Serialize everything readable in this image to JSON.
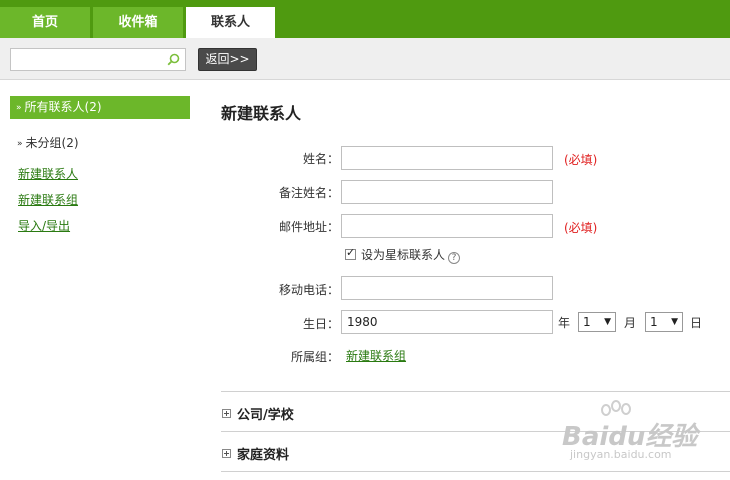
{
  "tabs": [
    {
      "label": "首页",
      "active": false
    },
    {
      "label": "收件箱",
      "active": false
    },
    {
      "label": "联系人",
      "active": true
    }
  ],
  "toolbar": {
    "search_value": "",
    "search_icon": "search-icon",
    "back_label": "返回>>"
  },
  "sidebar": {
    "header": "所有联系人(2)",
    "group": "未分组(2)",
    "links": [
      "新建联系人",
      "新建联系组",
      "导入/导出"
    ]
  },
  "main": {
    "title": "新建联系人",
    "fields": {
      "name_label": "姓名：",
      "name_value": "",
      "name_required": "(必填)",
      "alias_label": "备注姓名：",
      "alias_value": "",
      "email_label": "邮件地址：",
      "email_value": "",
      "email_required": "(必填)",
      "star_label": "设为星标联系人",
      "star_checked": true,
      "help_icon": "help-icon",
      "mobile_label": "移动电话：",
      "mobile_value": "",
      "birthday_label": "生日：",
      "birth_year": "1980",
      "year_unit": "年",
      "birth_month": "1",
      "month_unit": "月",
      "birth_day": "1",
      "day_unit": "日",
      "group_label": "所属组：",
      "group_link": "新建联系组"
    },
    "sections": [
      "公司/学校",
      "家庭资料"
    ]
  },
  "watermark": {
    "main": "Baidu经验",
    "sub": "jingyan.baidu.com"
  },
  "colors": {
    "topbar": "#4f9a10",
    "tab": "#6cb72a",
    "link": "#2a7a11",
    "required": "#e02020"
  }
}
